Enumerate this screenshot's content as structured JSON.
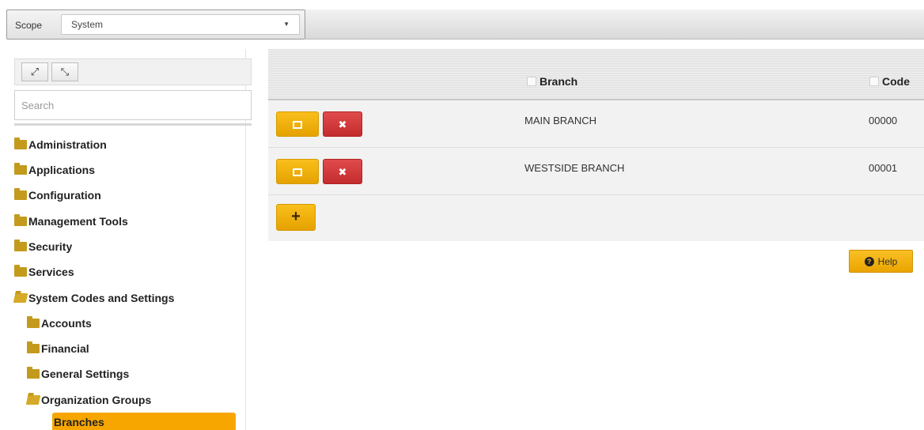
{
  "scope": {
    "label": "Scope",
    "value": "System",
    "caret": "▼"
  },
  "tree_toolbar": {
    "expand_glyph": "⤢",
    "collapse_glyph": "⤡"
  },
  "search": {
    "placeholder": "Search"
  },
  "tree": {
    "items": [
      {
        "label": "Administration",
        "icon": "folder-icon"
      },
      {
        "label": "Applications",
        "icon": "folder-icon"
      },
      {
        "label": "Configuration",
        "icon": "folder-icon"
      },
      {
        "label": "Management Tools",
        "icon": "folder-icon"
      },
      {
        "label": "Security",
        "icon": "folder-icon"
      },
      {
        "label": "Services",
        "icon": "folder-icon"
      },
      {
        "label": "System Codes and Settings",
        "icon": "folder-open-icon"
      },
      {
        "label": "Accounts",
        "icon": "folder-icon"
      },
      {
        "label": "Financial",
        "icon": "folder-icon"
      },
      {
        "label": "General Settings",
        "icon": "folder-icon"
      },
      {
        "label": "Organization Groups",
        "icon": "folder-open-icon"
      },
      {
        "label": "Branches",
        "selected": true
      }
    ]
  },
  "grid": {
    "columns": [
      "Branch",
      "Code"
    ],
    "rows": [
      {
        "branch": "MAIN BRANCH",
        "code": "00000"
      },
      {
        "branch": "WESTSIDE BRANCH",
        "code": "00001"
      }
    ],
    "delete_glyph": "✖",
    "add_glyph": "+"
  },
  "help": {
    "label": "Help",
    "icon_glyph": "?"
  },
  "colors": {
    "accent": "#f7a600",
    "delete": "#d23a3a",
    "folder": "#c49a1c"
  }
}
